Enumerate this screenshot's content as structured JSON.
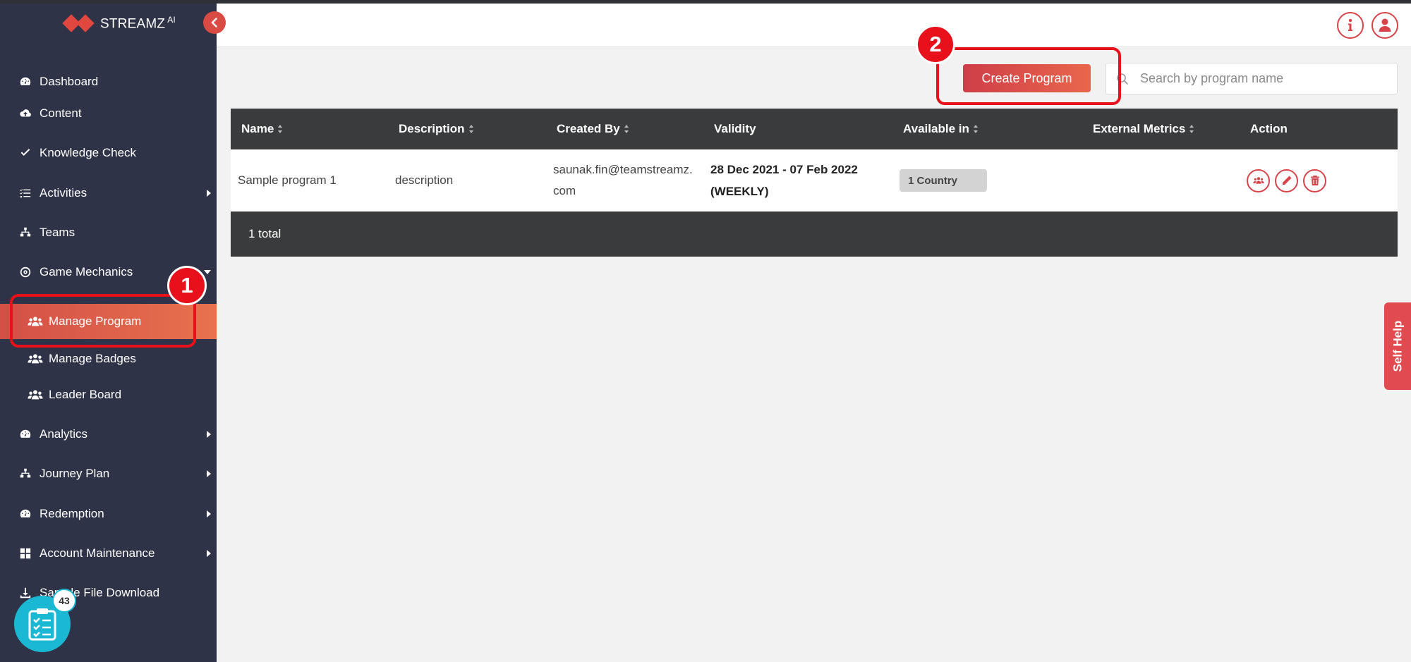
{
  "app": {
    "logo_text": "STREAMZ",
    "logo_sup": "AI",
    "colors": {
      "sidebar": "#2e3347",
      "accent": "#d94a45",
      "active_gradient_start": "#d34f47",
      "active_gradient_end": "#e8724e",
      "table_header": "#3a3b3c",
      "annotation": "#e8101a",
      "fab": "#1bb8d4"
    }
  },
  "sidebar": {
    "items": [
      {
        "label": "Dashboard",
        "icon": "gauge-icon"
      },
      {
        "label": "Content",
        "icon": "cloud-upload-icon"
      },
      {
        "label": "Knowledge Check",
        "icon": "check-icon"
      },
      {
        "label": "Activities",
        "icon": "list-check-icon",
        "has_submenu": true
      },
      {
        "label": "Teams",
        "icon": "hierarchy-icon"
      },
      {
        "label": "Game Mechanics",
        "icon": "target-icon",
        "expanded": true
      },
      {
        "label": "Analytics",
        "icon": "gauge-icon",
        "has_submenu": true
      },
      {
        "label": "Journey Plan",
        "icon": "hierarchy-icon",
        "has_submenu": true
      },
      {
        "label": "Redemption",
        "icon": "gauge-icon",
        "has_submenu": true
      },
      {
        "label": "Account Maintenance",
        "icon": "grid-icon",
        "has_submenu": true
      },
      {
        "label": "Sample File Download",
        "icon": "download-icon"
      }
    ],
    "subitems": [
      {
        "label": "Manage Program",
        "icon": "users-icon",
        "active": true
      },
      {
        "label": "Manage Badges",
        "icon": "users-icon"
      },
      {
        "label": "Leader Board",
        "icon": "users-icon"
      }
    ]
  },
  "annotations": {
    "first": "1",
    "second": "2"
  },
  "fab": {
    "badge_count": "43",
    "icon": "clipboard-checklist-icon"
  },
  "header": {
    "info_icon": "info-icon",
    "user_icon": "user-icon"
  },
  "toolbar": {
    "create_label": "Create Program",
    "search_placeholder": "Search by program name",
    "search_value": ""
  },
  "table": {
    "columns": [
      "Name",
      "Description",
      "Created By",
      "Validity",
      "Available in",
      "External Metrics",
      "Action"
    ],
    "rows": [
      {
        "name": "Sample program 1",
        "description": "description",
        "created_by_line1": "saunak.fin@teamstreamz.",
        "created_by_line2": "com",
        "validity_line1": "28 Dec 2021 - 07 Feb 2022",
        "validity_line2": "(WEEKLY)",
        "available_in": "1 Country",
        "external_metrics": ""
      }
    ],
    "footer": "1 total"
  },
  "self_help": {
    "label": "Self Help"
  }
}
